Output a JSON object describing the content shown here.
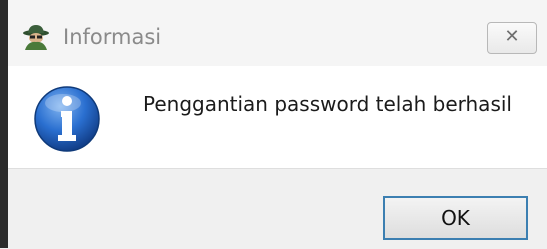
{
  "window": {
    "title": "Informasi",
    "app_icon": "spy-agent-icon",
    "close_icon": "close-icon"
  },
  "dialog": {
    "icon": "information-icon",
    "message": "Penggantian password telah berhasil"
  },
  "buttons": {
    "ok_label": "OK"
  },
  "colors": {
    "title_bar_bg": "#f5f5f5",
    "title_text": "#8a8a8a",
    "content_bg": "#ffffff",
    "footer_bg": "#f0f0f0",
    "info_icon_blue": "#1e5fb5",
    "ok_button_border": "#3c7fb1"
  }
}
